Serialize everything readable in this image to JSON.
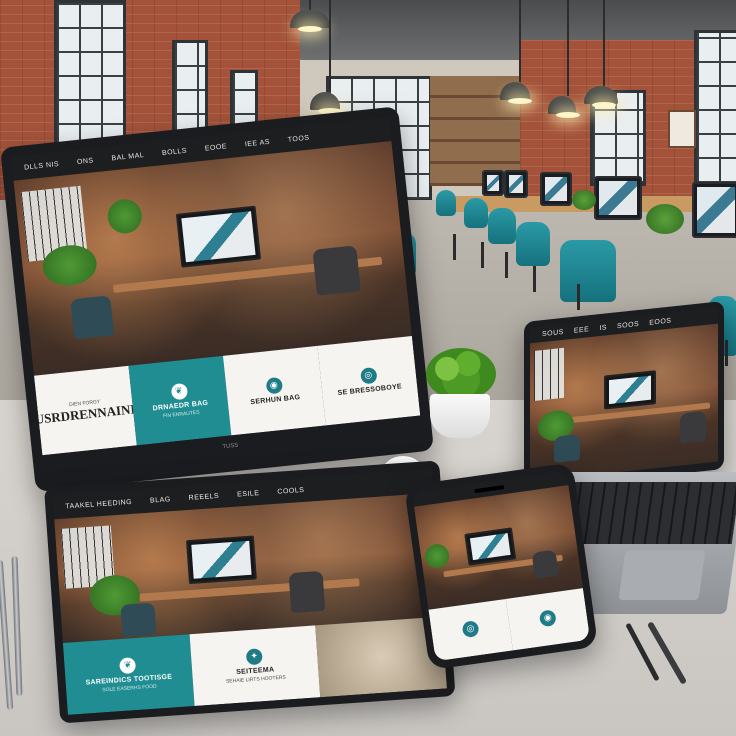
{
  "scene": {
    "description_tag": "responsive-website-showcase-office",
    "colors": {
      "teal_accent": "#1f8d92",
      "brick": "#a4533a",
      "chair_teal": "#2a9aa6",
      "nav_dark": "#1d1e20"
    }
  },
  "monitor_site": {
    "nav_items": [
      "DLLS NIS",
      "ONS",
      "BAL MAL",
      "BOLLS",
      "EOOE",
      "IEE AS",
      "TOOS"
    ],
    "cards": [
      {
        "title": "SUSRDRENNAINIE",
        "subtitle": "DIEN FORGY",
        "icon": "logo-icon"
      },
      {
        "title": "DRNAEDR BAG",
        "subtitle": "FIN ENRAUTES",
        "icon": "leaf-icon"
      },
      {
        "title": "SERHUN BAG",
        "subtitle": "",
        "icon": "globe-icon"
      },
      {
        "title": "SE BRESSOBOYE",
        "subtitle": "",
        "icon": "ring-icon"
      }
    ],
    "brand": "TUSS"
  },
  "tablet_site": {
    "nav_items": [
      "TAAKEL HEEDING",
      "BLAG",
      "REEELS",
      "ESILE",
      "COOLS"
    ],
    "cards": [
      {
        "title": "SAREINDICS TOOTISGE",
        "subtitle": "SOLE EASERHS FOOD",
        "icon": "leaf-icon"
      },
      {
        "title": "SEITEEMA",
        "subtitle": "SEHAIE LIRTS HOOTERS",
        "icon": "sparkle-icon"
      }
    ]
  },
  "phone_site": {
    "cards": [
      {
        "title": "",
        "icon": "ring-icon"
      },
      {
        "title": "",
        "icon": "globe-icon"
      }
    ]
  },
  "laptop_site": {
    "nav_items": [
      "SOUS",
      "EEE",
      "IS",
      "SOOS",
      "EOOS"
    ]
  }
}
